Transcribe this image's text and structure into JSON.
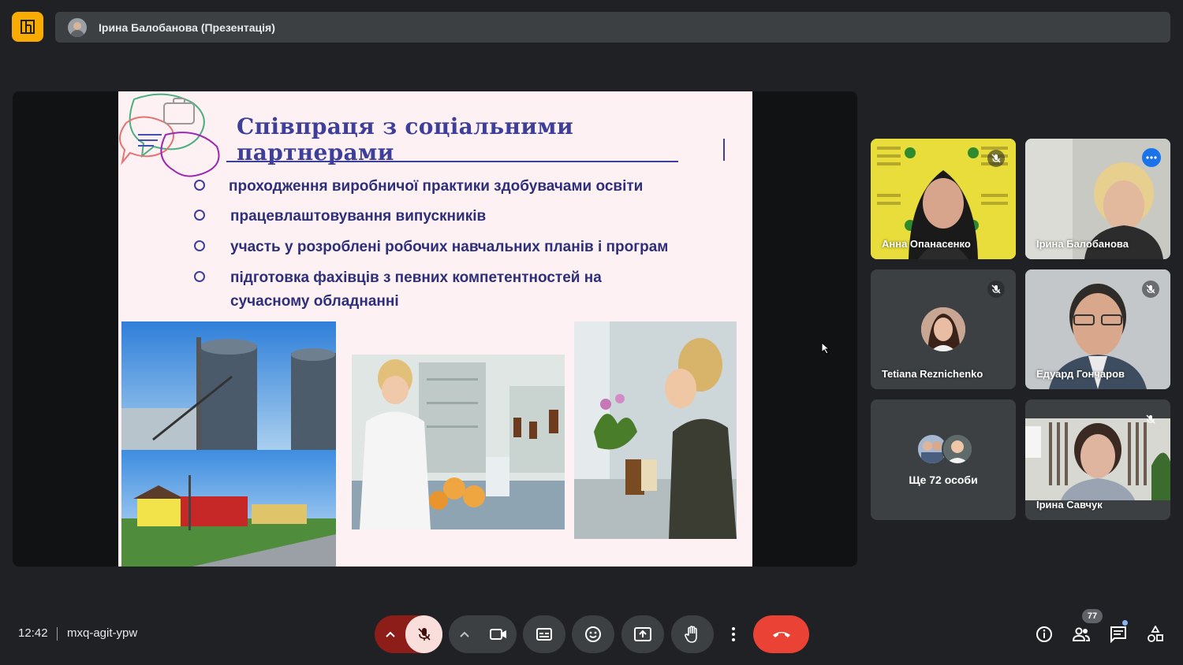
{
  "header": {
    "presenter_title": "Ірина Балобанова (Презентація)"
  },
  "slide": {
    "title": "Співпраця з соціальними партнерами",
    "bullets": [
      "проходження виробничої практики здобувачами освіти",
      "працевлаштовування випускників",
      "участь у розроблені робочих навчальних планів і програм",
      "підготовка фахівців з певних компетентностей на сучасному обладнанні"
    ]
  },
  "participants": [
    {
      "name": "Анна Опанасенко"
    },
    {
      "name": "Ірина Балобанова"
    },
    {
      "name": "Tetiana Reznichenko"
    },
    {
      "name": "Едуард Гончаров"
    },
    {
      "name": "Ще 72 особи"
    },
    {
      "name": "Ірина Савчук"
    }
  ],
  "footer": {
    "time": "12:42",
    "meeting_code": "mxq-agit-ypw",
    "people_count": "77"
  },
  "icons": {
    "layout": "layout-icon",
    "more_options_tile": "more-options-icon",
    "muted": "mic-off-icon",
    "camera": "videocam-icon",
    "captions": "closed-caption-icon",
    "emoji": "emoji-icon",
    "present": "present-screen-icon",
    "hand": "raise-hand-icon",
    "more": "more-vert-icon",
    "end_call": "call-end-icon",
    "info": "info-icon",
    "people": "people-icon",
    "chat": "chat-icon",
    "activities": "activities-icon"
  },
  "colors": {
    "background": "#202124",
    "surface": "#3c4043",
    "accent_yellow": "#f9ab00",
    "mic_off_bg": "#f9dedc",
    "end_call": "#ea4335",
    "speaking_border": "#8ab4f8",
    "slide_text": "#3d3f9a"
  }
}
